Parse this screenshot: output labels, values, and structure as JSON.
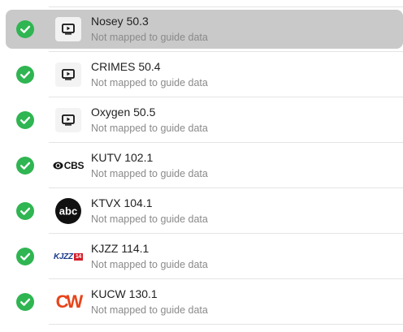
{
  "channels": [
    {
      "name": "Nosey 50.3",
      "status": "Not mapped to guide data",
      "logo": "tv-play-icon",
      "selected": true
    },
    {
      "name": "CRIMES 50.4",
      "status": "Not mapped to guide data",
      "logo": "tv-play-icon",
      "selected": false
    },
    {
      "name": "Oxygen 50.5",
      "status": "Not mapped to guide data",
      "logo": "tv-play-icon",
      "selected": false
    },
    {
      "name": "KUTV 102.1",
      "status": "Not mapped to guide data",
      "logo": "cbs-logo",
      "logo_text": "CBS",
      "selected": false
    },
    {
      "name": "KTVX 104.1",
      "status": "Not mapped to guide data",
      "logo": "abc-logo",
      "logo_text": "abc",
      "selected": false
    },
    {
      "name": "KJZZ 114.1",
      "status": "Not mapped to guide data",
      "logo": "kjzz-logo",
      "logo_text": "KJZZ",
      "logo_badge": "14",
      "selected": false
    },
    {
      "name": "KUCW 130.1",
      "status": "Not mapped to guide data",
      "logo": "cw-logo",
      "logo_text": "CW",
      "selected": false
    }
  ],
  "colors": {
    "check_green": "#2fb551",
    "selected_row": "#c9c9c9",
    "name_text": "#222222",
    "status_text": "#8a8a8a",
    "divider": "#e4e4e4"
  }
}
